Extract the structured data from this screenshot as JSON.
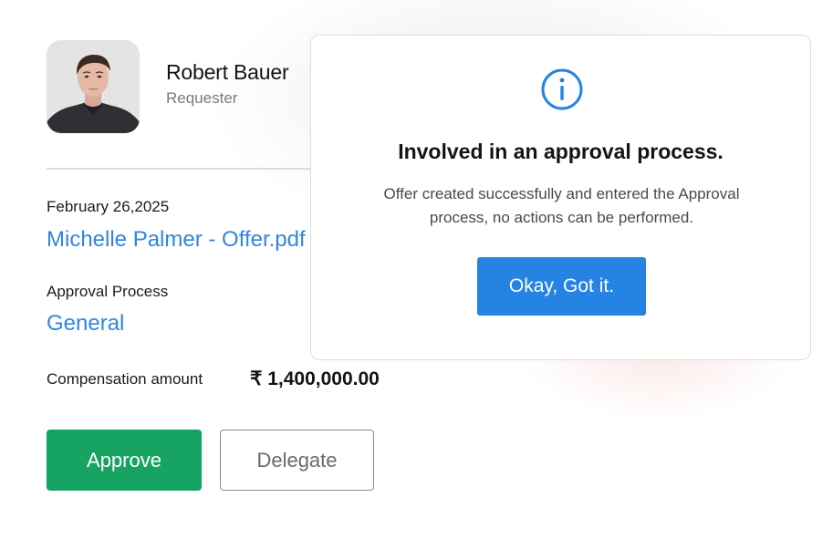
{
  "requester": {
    "name": "Robert Bauer",
    "role": "Requester",
    "avatar_icon": "person-photo"
  },
  "request": {
    "date": "February 26,2025",
    "offer_link": "Michelle Palmer - Offer.pdf",
    "approval_process_label": "Approval Process",
    "approval_process_value": "General",
    "compensation_label": "Compensation amount",
    "compensation_value": "₹ 1,400,000.00"
  },
  "actions": {
    "approve_label": "Approve",
    "delegate_label": "Delegate"
  },
  "modal": {
    "icon": "info-icon",
    "title": "Involved in an approval process.",
    "body": "Offer created successfully and entered the Approval process, no actions can be performed.",
    "button_label": "Okay, Got it."
  },
  "colors": {
    "link_blue": "#2f86e0",
    "approve_green": "#17a463",
    "primary_blue": "#2583e3"
  }
}
